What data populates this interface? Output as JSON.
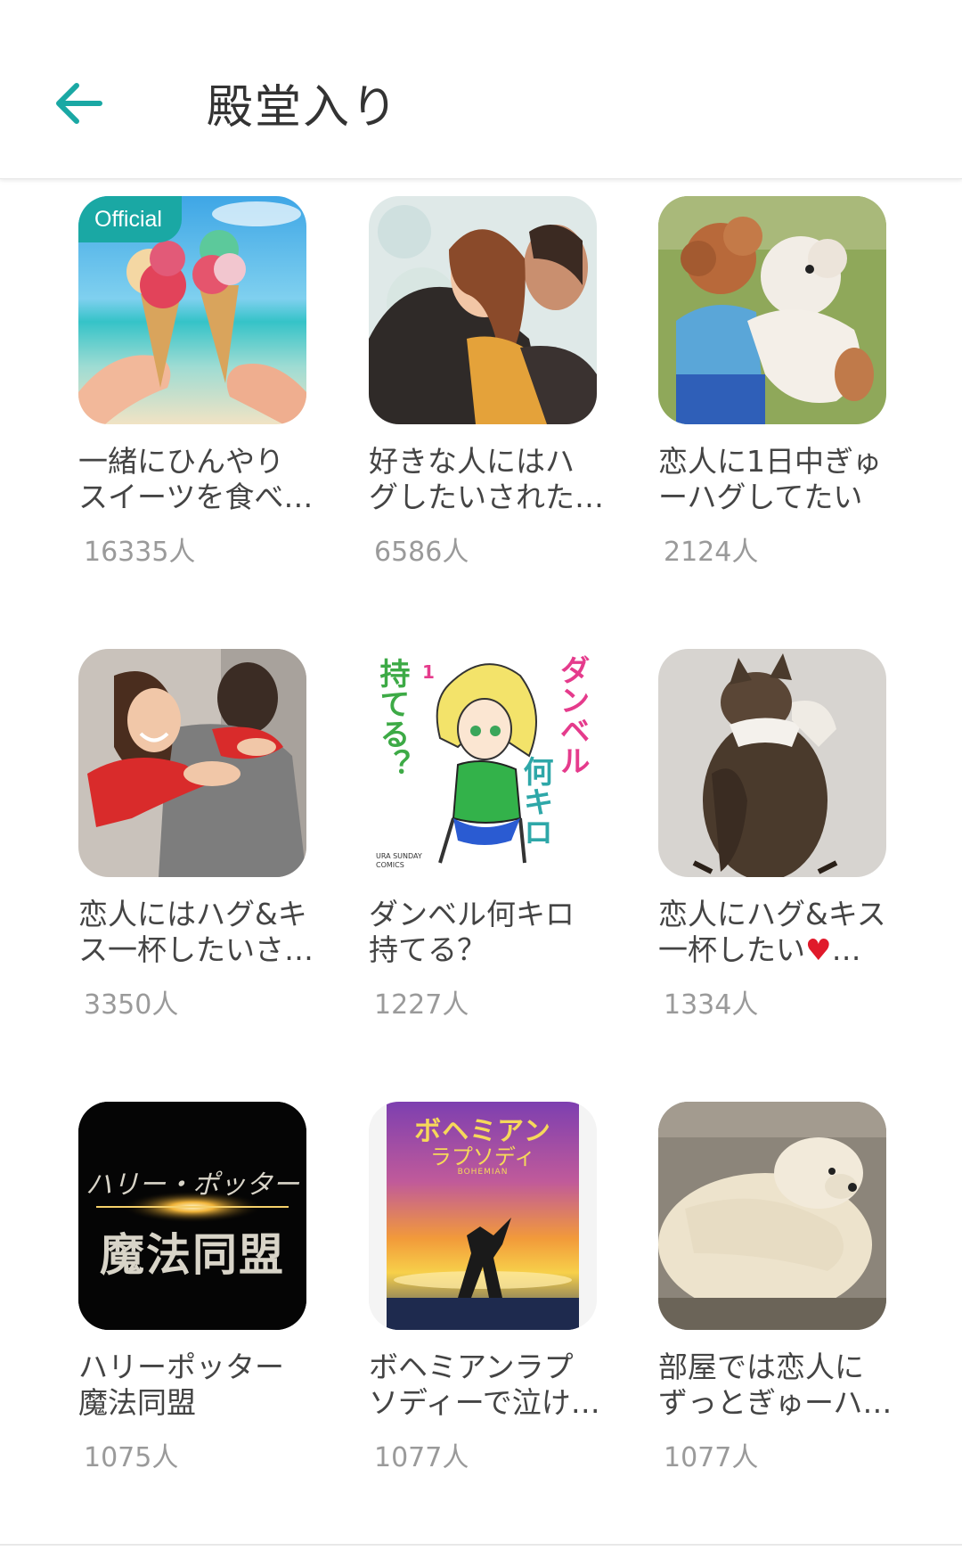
{
  "header": {
    "title": "殿堂入り"
  },
  "cards": [
    {
      "line1": "一緒にひんやり",
      "line2": "スイーツを食べ…",
      "count": "16335人",
      "badge": "Official"
    },
    {
      "line1": "好きな人にはハ",
      "line2": "グしたいされた…",
      "count": "6586人"
    },
    {
      "line1": "恋人に1日中ぎゅ",
      "line2": "ーハグしてたい",
      "count": "2124人"
    },
    {
      "line1": "恋人にはハグ&キ",
      "line2": "ス一杯したいさ…",
      "count": "3350人"
    },
    {
      "line1": "ダンベル何キロ",
      "line2": "持てる？",
      "count": "1227人",
      "art": {
        "vertical_a": "ダンベル",
        "vertical_b": "何キロ",
        "left": "持てる？",
        "num": "1",
        "small": "URA SUNDAY COMICS"
      }
    },
    {
      "line1": "恋人にハグ&キス",
      "line2a": "一杯したい",
      "line2_heart": "♥",
      "line2b": "…",
      "count": "1334人"
    },
    {
      "line1": "ハリーポッター",
      "line2": "魔法同盟",
      "count": "1075人",
      "art": {
        "top": "ハリー・ポッター",
        "bottom": "魔法同盟"
      }
    },
    {
      "line1": "ボヘミアンラプ",
      "line2": "ソディーで泣け…",
      "count": "1077人",
      "art": {
        "top": "ボヘミアン",
        "sub": "ラプソディ",
        "small": "BOHEMIAN"
      }
    },
    {
      "line1": "部屋では恋人に",
      "line2": "ずっとぎゅーハ…",
      "count": "1077人"
    }
  ],
  "colors": {
    "accent": "#1aa8a4",
    "title_text": "#333333",
    "body_text": "#444444",
    "count_text": "#9a9a9a"
  },
  "icons": {
    "back": "arrow-left-icon"
  }
}
